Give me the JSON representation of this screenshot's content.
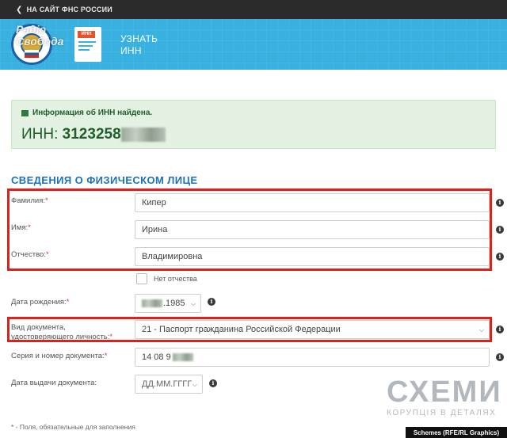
{
  "topbar": {
    "back_label": "НА САЙТ ФНС РОССИИ"
  },
  "header": {
    "title_line1": "УЗНАТЬ",
    "title_line2": "ИНН",
    "watermark_line1": "Радіо",
    "watermark_line2": "Свобода",
    "doc_icon_tag": "ИНН"
  },
  "alert": {
    "message": "Информация об ИНН найдена.",
    "inn_label": "ИНН:",
    "inn_value": "3123258"
  },
  "section_title": "СВЕДЕНИЯ О ФИЗИЧЕСКОМ ЛИЦЕ",
  "form": {
    "surname": {
      "label": "Фамилия:",
      "required": "*",
      "value": "Кипер"
    },
    "name": {
      "label": "Имя:",
      "required": "*",
      "value": "Ирина"
    },
    "patronymic": {
      "label": "Отчество:",
      "required": "*",
      "value": "Владимировна"
    },
    "no_patronymic": {
      "label": "Нет отчества",
      "checked": false
    },
    "birth_date": {
      "label": "Дата рождения:",
      "required": "*",
      "value": ".1985"
    },
    "doc_type": {
      "label_line1": "Вид документа,",
      "label_line2": "удостоверяющего личность:",
      "required": "*",
      "value": "21 - Паспорт гражданина Российской Федерации"
    },
    "doc_number": {
      "label": "Серия и номер документа:",
      "required": "*",
      "value": "14 08 9"
    },
    "issue_date": {
      "label": "Дата выдачи документа:",
      "placeholder": "ДД.ММ.ГГГГ"
    }
  },
  "footnote": "* - Поля, обязательные для заполнения",
  "brand": {
    "name": "СХЕМИ",
    "tagline": "КОРУПЦІЯ В ДЕТАЛЯХ"
  },
  "credit": "Schemes (RFE/RL Graphics)",
  "colors": {
    "header_bg": "#38b1e0",
    "topbar_bg": "#2b2b2b",
    "alert_bg": "#e4f2e3",
    "section_title": "#1c72b8",
    "highlight_box": "#e0201c"
  },
  "icons": {
    "back": "chevron-left-icon",
    "gift": "gift-icon",
    "info": "info-icon",
    "dropdown": "chevron-down-icon"
  }
}
